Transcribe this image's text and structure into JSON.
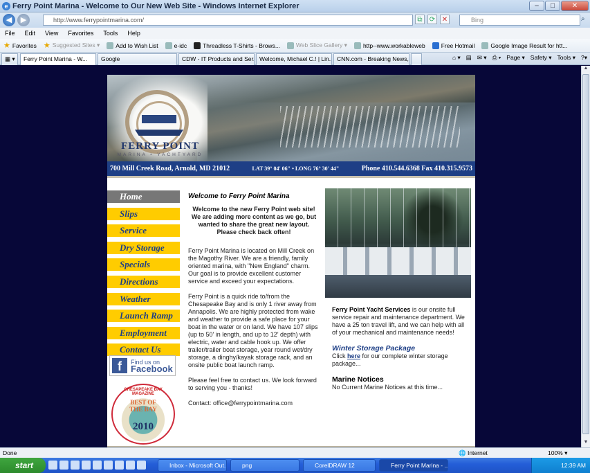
{
  "window": {
    "title": "Ferry Point Marina - Welcome to Our New Web Site - Windows Internet Explorer",
    "url": "http://www.ferrypointmarina.com/",
    "search_placeholder": "Bing"
  },
  "menu": [
    "File",
    "Edit",
    "View",
    "Favorites",
    "Tools",
    "Help"
  ],
  "favorites_bar": {
    "label": "Favorites",
    "items": [
      "Suggested Sites ▾",
      "Add to Wish List",
      "e-idc",
      "Threadless T-Shirts - Brows...",
      "Web Slice Gallery ▾",
      "http--www.workableweb",
      "Free Hotmail",
      "Google Image Result for htt..."
    ]
  },
  "tabs": [
    "Ferry Point Marina - W...",
    "Google",
    "CDW - IT Products and Ser...",
    "Welcome, Michael C.! | Lin...",
    "CNN.com - Breaking News,..."
  ],
  "commands": [
    "Page ▾",
    "Safety ▾",
    "Tools ▾"
  ],
  "site": {
    "logo": "FERRY POINT",
    "logo_sub": "MARINA • YACHTYARD",
    "address": "700 Mill Creek Road, Arnold, MD 21012",
    "coords": "LAT 39° 04' 06\" • LONG 76° 30' 44\"",
    "phone_fax": "Phone 410.544.6368  Fax 410.315.9573",
    "nav": [
      "Home",
      "Slips",
      "Service",
      "Dry Storage",
      "Specials",
      "Directions",
      "Weather",
      "Launch Ramp",
      "Employment",
      "Contact Us"
    ],
    "facebook": {
      "line1": "Find us on",
      "line2": "Facebook"
    },
    "award": {
      "ring": "CHESAPEAKE BAY MAGAZINE",
      "best": "BEST OF THE BAY",
      "year": "2010"
    },
    "welcome_title": "Welcome to Ferry Point Marina",
    "lead": "Welcome to the new Ferry Point web site! We are adding more content as we go, but wanted to share the great new layout. Please check back often!",
    "para1": "Ferry Point Marina is located on Mill Creek on the Magothy River. We are a friendly, family oriented marina, with \"New England\" charm. Our goal is to provide excellent customer service and exceed your expectations.",
    "para2": "Ferry Point is a quick ride to/from the Chesapeake Bay and is only 1 river away from Annapolis. We are highly protected from wake and weather to provide a safe place for your boat in the water or on land. We have 107 slips (up to 50' in length, and up to 12' depth) with electric, water and cable hook up.  We offer trailer/trailer boat storage, year round wet/dry storage, a dinghy/kayak storage rack, and an onsite public boat launch ramp.",
    "para3": "Please feel free to contact us. We look forward to serving you - thanks!",
    "contact": "Contact: office@ferrypointmarina.com",
    "yacht_services_title": "Ferry Point Yacht Services",
    "yacht_services_text": " is our onsite full service repair and maintenance department. We have a 25 ton travel lift, and we can help with all of your mechanical and maintenance needs!",
    "winter_title": "Winter Storage Package",
    "winter_click": "Click ",
    "winter_link": "here",
    "winter_rest": " for our complete winter storage package...",
    "marine_title": "Marine Notices",
    "marine_text": "No Current Marine Notices at this time..."
  },
  "status": {
    "left": "Done",
    "zone": "Internet",
    "zoom": "100% ▾"
  },
  "taskbar": {
    "start": "start",
    "tasks": [
      "Inbox - Microsoft Out...",
      "png",
      "CorelDRAW 12",
      "Ferry Point Marina - ..."
    ],
    "clock": "12:39 AM"
  }
}
